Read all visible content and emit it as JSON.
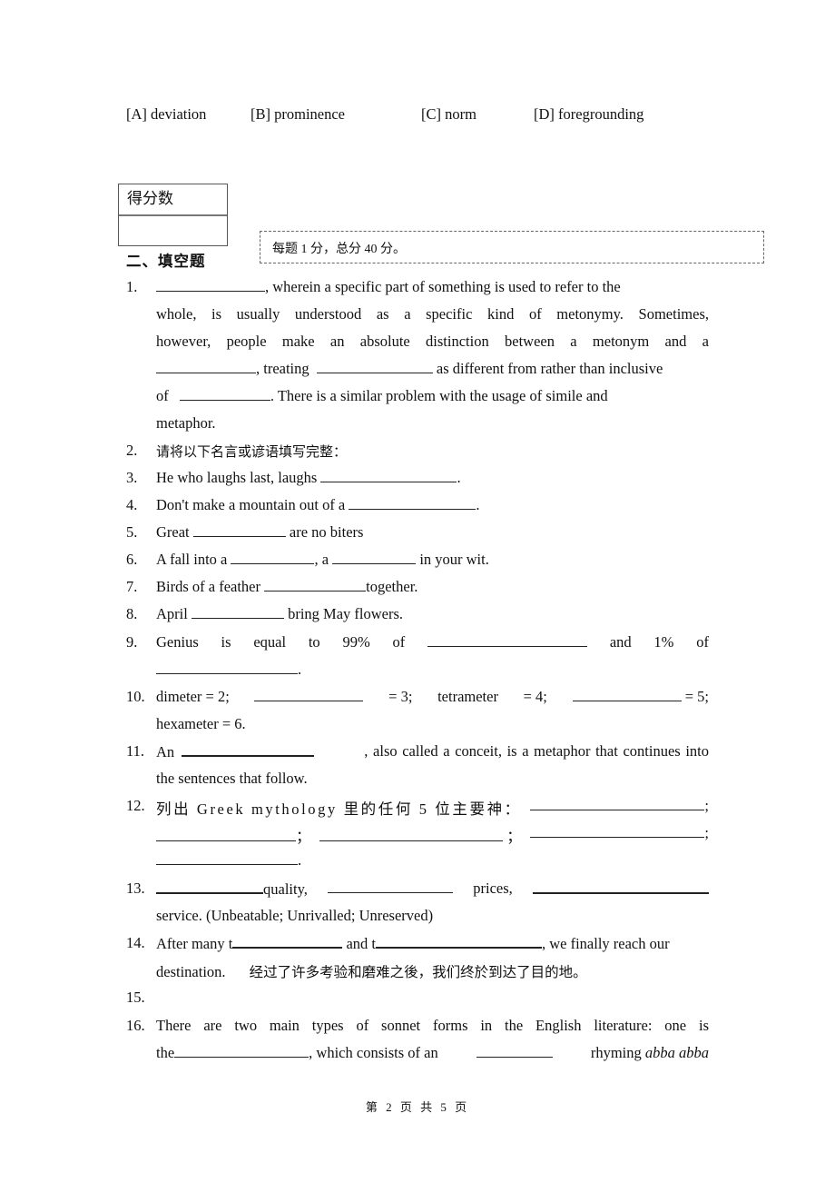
{
  "options": {
    "a": "[A] deviation",
    "b": "[B] prominence",
    "c": "[C] norm",
    "d": "[D] foregrounding"
  },
  "score_box": {
    "label": "得分数",
    "value": ""
  },
  "section": {
    "title": "二、填空题",
    "note": "每题 1 分，总分 40 分。"
  },
  "questions": {
    "q1": {
      "num": "1.",
      "l1_end": ", wherein a specific part of something is used to refer to the",
      "l2": "whole, is usually understood as a specific kind of metonymy. Sometimes,",
      "l3": "however, people make an absolute distinction between a metonym and a",
      "l4_a": ", treating",
      "l4_b": "as different from rather than inclusive",
      "l5_a": "of",
      "l5_b": ". There is a similar problem with the usage of simile and",
      "l6": "metaphor."
    },
    "q2": {
      "num": "2.",
      "text": "请将以下名言或谚语填写完整："
    },
    "q3": {
      "num": "3.",
      "a": "He who laughs last, laughs",
      "b": "."
    },
    "q4": {
      "num": "4.",
      "a": "Don't make a mountain out of a",
      "b": "."
    },
    "q5": {
      "num": "5.",
      "a": "Great",
      "b": "are no biters"
    },
    "q6": {
      "num": "6.",
      "a": "A fall into a",
      "b": ", a",
      "c": "in your wit."
    },
    "q7": {
      "num": "7.",
      "a": "Birds of a feather",
      "b": "together."
    },
    "q8": {
      "num": "8.",
      "a": "April",
      "b": "bring May flowers."
    },
    "q9": {
      "num": "9.",
      "words": [
        "Genius",
        "is",
        "equal",
        "to",
        "99%",
        "of"
      ],
      "mid": "and",
      "pct": "1%",
      "of": "of",
      "end": "."
    },
    "q10": {
      "num": "10.",
      "a": "dimeter = 2;",
      "b": "= 3;",
      "c": "tetrameter",
      "d": "= 4;",
      "e": "= 5;",
      "l2": "hexameter = 6."
    },
    "q11": {
      "num": "11.",
      "a": "An",
      "b": ", also called a conceit, is a metaphor that continues into",
      "l2": "the sentences that follow."
    },
    "q12": {
      "num": "12.",
      "a": "列出 Greek mythology 里的任何 5 位主要神：",
      "semi": ";",
      "semi_cn": "；",
      "end": "."
    },
    "q13": {
      "num": "13.",
      "a": "quality,",
      "b": "prices,",
      "l2": "service. (Unbeatable; Unrivalled; Unreserved)"
    },
    "q14": {
      "num": "14.",
      "a": "After many t",
      "b": "and t",
      "c": ", we finally reach our",
      "l2_en": "destination.",
      "l2_cn": "经过了许多考验和磨难之後，我们终於到达了目的地。"
    },
    "q15": {
      "num": "15."
    },
    "q16": {
      "num": "16.",
      "l1": "There are two main types of sonnet forms in the English literature: one is",
      "l2_a": "the",
      "l2_b": ", which consists of an",
      "l2_c": "rhyming",
      "l2_d": "abba abba"
    }
  },
  "footer": {
    "page": "第 2 页 共 5 页"
  }
}
